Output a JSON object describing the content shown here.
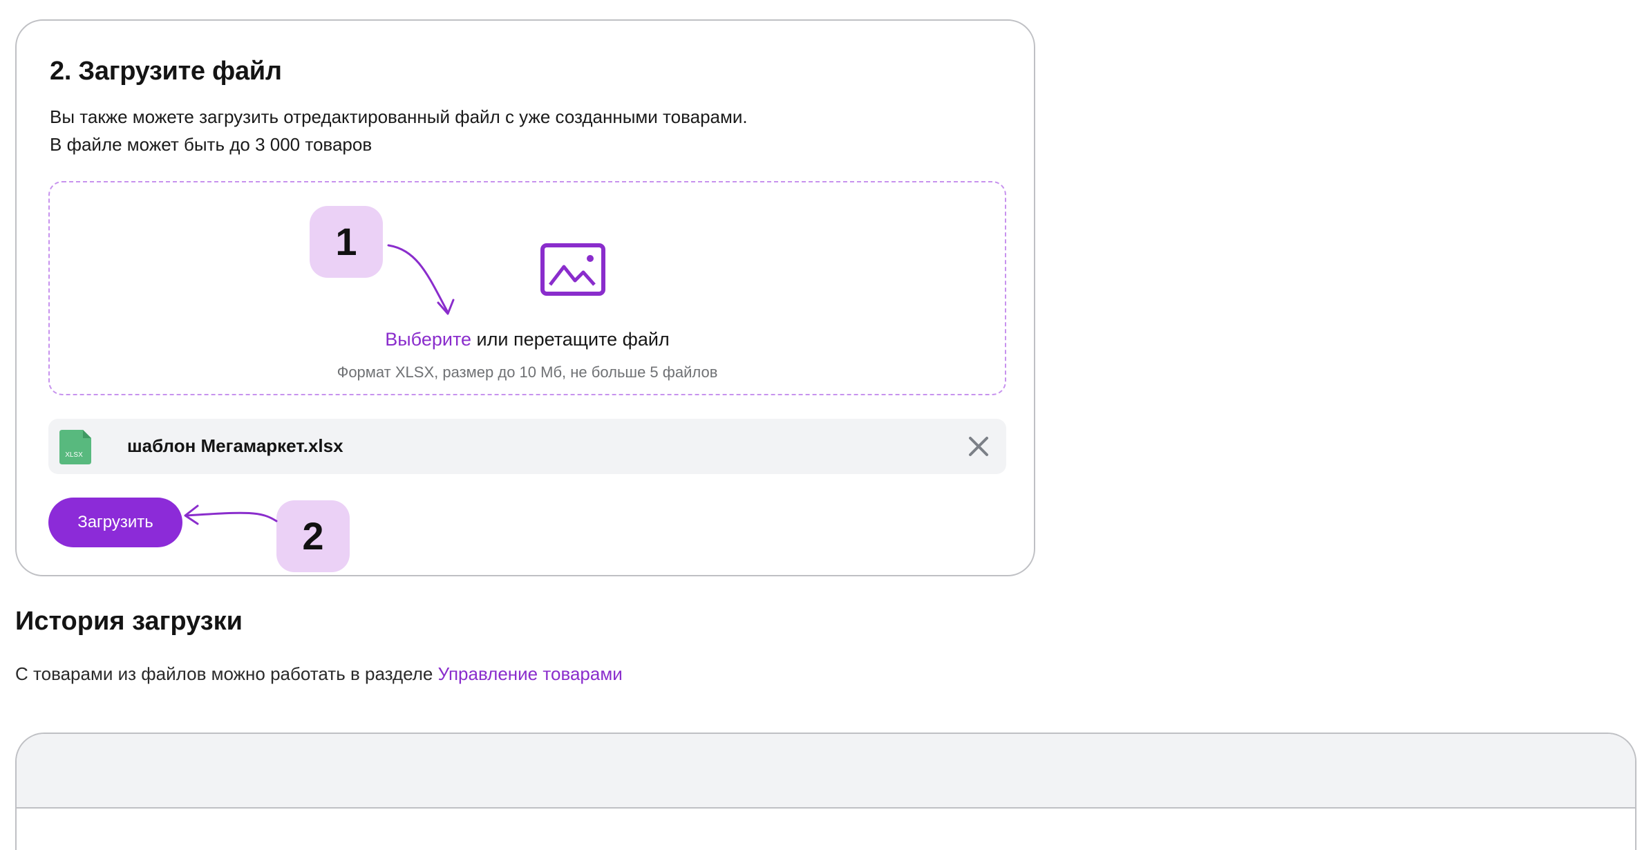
{
  "upload_card": {
    "title": "2. Загрузите файл",
    "description_line1": "Вы также можете загрузить отредактированный файл с уже созданными товарами.",
    "description_line2": "В файле может быть до 3 000 товаров",
    "dropzone": {
      "icon": "image-icon",
      "choose_link": "Выберите",
      "drag_text": " или перетащите файл",
      "hint": "Формат XLSX, размер до 10 Мб, не больше 5 файлов"
    },
    "file": {
      "icon": "xlsx-file-icon",
      "icon_label": "XLSX",
      "name": "шаблон Мегамаркет.xlsx",
      "remove_icon": "close-icon"
    },
    "upload_button": "Загрузить"
  },
  "callouts": {
    "first": "1",
    "second": "2"
  },
  "history": {
    "title": "История загрузки",
    "subtitle_prefix": "С товарами из файлов можно работать в разделе ",
    "subtitle_link": "Управление товарами"
  },
  "colors": {
    "accent": "#8c2bd8",
    "link": "#8a2dcc",
    "callout_bg": "#ebd1f6",
    "dropzone_border": "#c792ee",
    "file_icon_green": "#58b97e"
  }
}
